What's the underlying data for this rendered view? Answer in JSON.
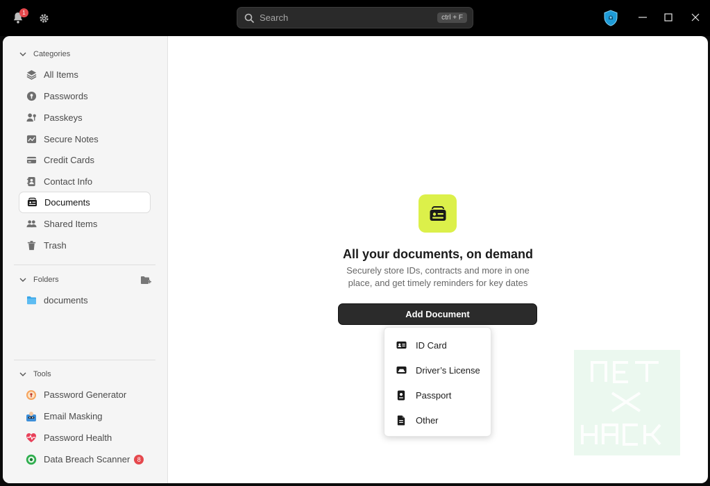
{
  "titlebar": {
    "notification_count": "1",
    "search_placeholder": "Search",
    "search_shortcut": "ctrl + F"
  },
  "sidebar": {
    "categories_label": "Categories",
    "categories": [
      {
        "label": "All Items",
        "icon": "layers-icon"
      },
      {
        "label": "Passwords",
        "icon": "key-icon"
      },
      {
        "label": "Passkeys",
        "icon": "passkey-icon"
      },
      {
        "label": "Secure Notes",
        "icon": "note-icon"
      },
      {
        "label": "Credit Cards",
        "icon": "credit-card-icon"
      },
      {
        "label": "Contact Info",
        "icon": "contact-icon"
      },
      {
        "label": "Documents",
        "icon": "document-card-icon",
        "active": true
      },
      {
        "label": "Shared Items",
        "icon": "people-icon"
      },
      {
        "label": "Trash",
        "icon": "trash-icon"
      }
    ],
    "folders_label": "Folders",
    "folders": [
      {
        "label": "documents",
        "icon": "folder-icon"
      }
    ],
    "tools_label": "Tools",
    "tools": [
      {
        "label": "Password Generator",
        "icon": "password-generator-icon"
      },
      {
        "label": "Email Masking",
        "icon": "email-masking-icon"
      },
      {
        "label": "Password Health",
        "icon": "heart-pulse-icon"
      },
      {
        "label": "Data Breach Scanner",
        "icon": "breach-scanner-icon",
        "badge": "8"
      }
    ]
  },
  "main": {
    "title": "All your documents, on demand",
    "subtitle": "Securely store IDs, contracts and more in one place, and get timely reminders for key dates",
    "add_button_label": "Add Document",
    "menu": [
      {
        "label": "ID Card",
        "icon": "id-card-icon"
      },
      {
        "label": "Driver’s License",
        "icon": "car-icon"
      },
      {
        "label": "Passport",
        "icon": "passport-icon"
      },
      {
        "label": "Other",
        "icon": "file-icon"
      }
    ]
  },
  "colors": {
    "accent": "#dcf04a",
    "badge": "#e5484d",
    "titlebar": "#000000"
  }
}
